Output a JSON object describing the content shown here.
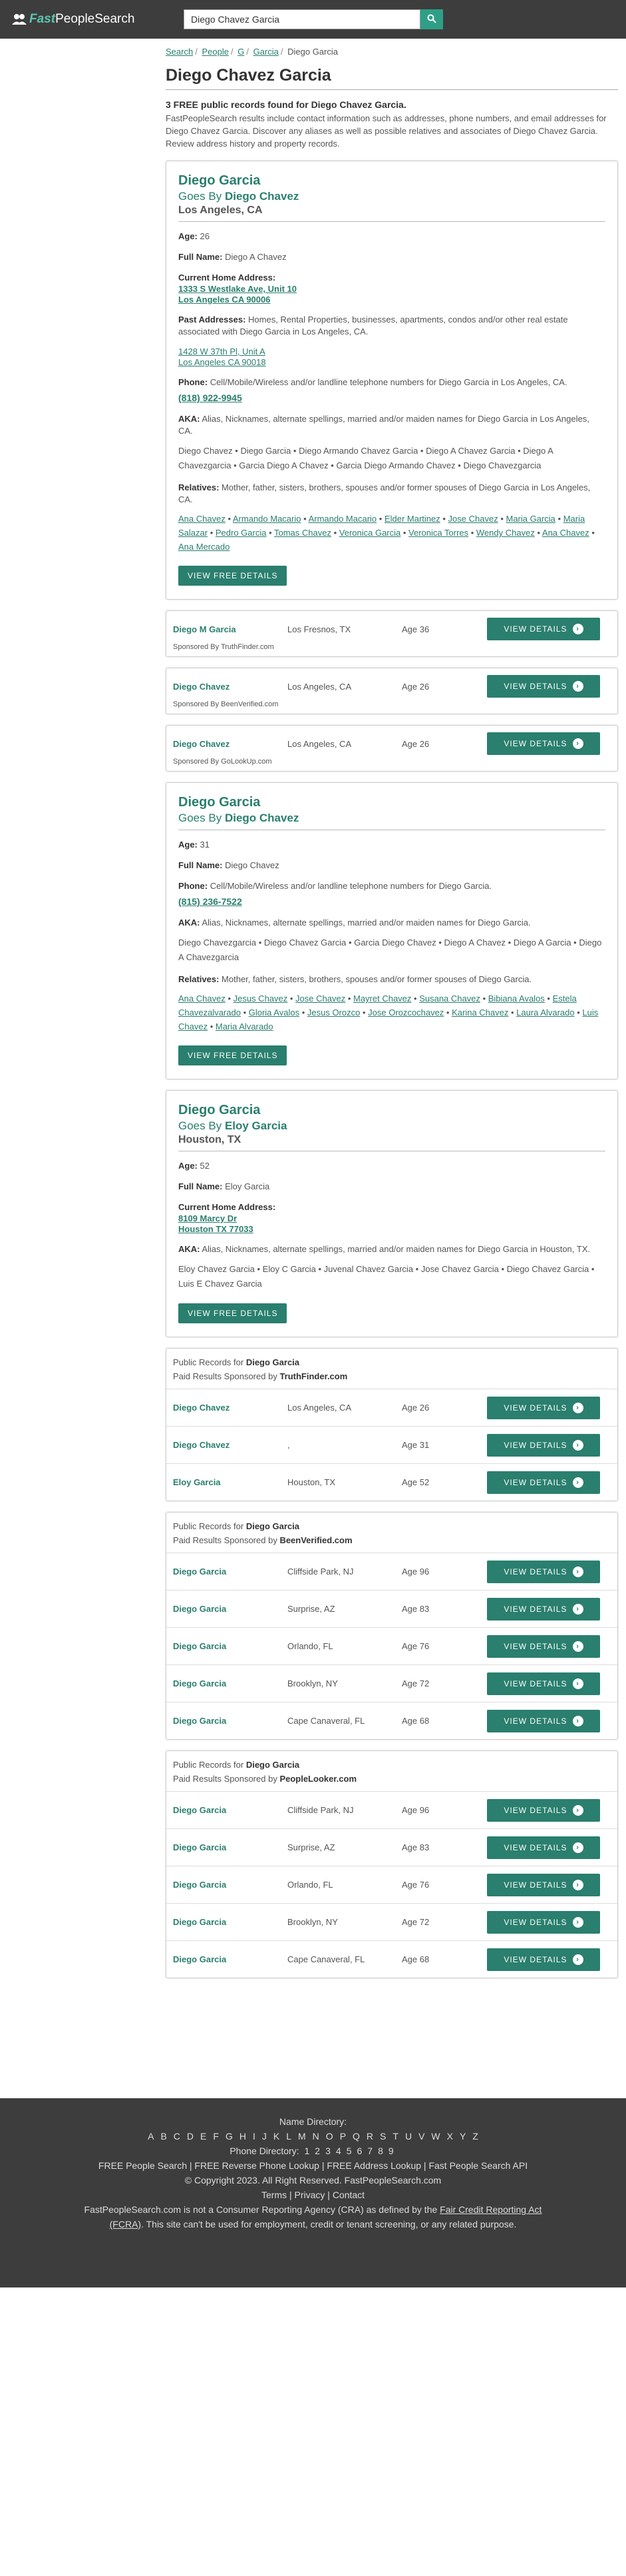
{
  "brand": {
    "fast": "Fast",
    "rest": "PeopleSearch"
  },
  "search": {
    "value": "Diego Chavez Garcia"
  },
  "breadcrumb": [
    "Search",
    "People",
    "G",
    "Garcia",
    "Diego Garcia"
  ],
  "page_title": "Diego Chavez Garcia",
  "summary": {
    "title": "3 FREE public records found for Diego Chavez Garcia.",
    "text": "FastPeopleSearch results include contact information such as addresses, phone numbers, and email addresses for Diego Chavez Garcia. Discover any aliases as well as possible relatives and associates of Diego Chavez Garcia. Review address history and property records."
  },
  "labels": {
    "age": "Age:",
    "full_name": "Full Name:",
    "current_address": "Current Home Address:",
    "past_addresses": "Past Addresses:",
    "phone": "Phone:",
    "aka": "AKA:",
    "relatives": "Relatives:",
    "goes_by": "Goes By",
    "view_free_details": "View Free Details",
    "view_details": "View Details",
    "public_records_for": "Public Records for",
    "paid_results": "Paid Results Sponsored by",
    "sponsored_by": "Sponsored By"
  },
  "record1": {
    "name": "Diego Garcia",
    "goes_by": "Diego Chavez",
    "location": "Los Angeles, CA",
    "age": "26",
    "full_name": "Diego A Chavez",
    "current_address_line1": "1333 S Westlake Ave, Unit 10",
    "current_address_line2": "Los Angeles CA 90006",
    "past_text": "Homes, Rental Properties, businesses, apartments, condos and/or other real estate associated with Diego Garcia in Los Angeles, CA.",
    "past_address_line1": "1428 W 37th Pl, Unit A",
    "past_address_line2": "Los Angeles CA 90018",
    "phone_text": "Cell/Mobile/Wireless and/or landline telephone numbers for Diego Garcia in Los Angeles, CA.",
    "phone": "(818) 922-9945",
    "aka_text": "Alias, Nicknames, alternate spellings, married and/or maiden names for Diego Garcia in Los Angeles, CA.",
    "aliases": [
      "Diego Chavez",
      "Diego Garcia",
      "Diego Armando Chavez Garcia",
      "Diego A Chavez Garcia",
      "Diego A Chavezgarcia",
      "Garcia Diego A Chavez",
      "Garcia Diego Armando Chavez",
      "Diego Chavezgarcia"
    ],
    "relatives_text": "Mother, father, sisters, brothers, spouses and/or former spouses of Diego Garcia in Los Angeles, CA.",
    "relatives": [
      "Ana Chavez",
      "Armando Macario",
      "Armando Macario",
      "Elder Martinez",
      "Jose Chavez",
      "Maria Garcia",
      "Maria Salazar",
      "Pedro Garcia",
      "Tomas Chavez",
      "Veronica Garcia",
      "Veronica Torres",
      "Wendy Chavez",
      "Ana Chavez",
      "Ana Mercado"
    ]
  },
  "sponsored": [
    {
      "name": "Diego M Garcia",
      "location": "Los Fresnos, TX",
      "age": "Age 36",
      "sponsor": "TruthFinder.com"
    },
    {
      "name": "Diego Chavez",
      "location": "Los Angeles, CA",
      "age": "Age 26",
      "sponsor": "BeenVerified.com"
    },
    {
      "name": "Diego Chavez",
      "location": "Los Angeles, CA",
      "age": "Age 26",
      "sponsor": "GoLookUp.com"
    }
  ],
  "record2": {
    "name": "Diego Garcia",
    "goes_by": "Diego Chavez",
    "age": "31",
    "full_name": "Diego Chavez",
    "phone_text": "Cell/Mobile/Wireless and/or landline telephone numbers for Diego Garcia.",
    "phone": "(815) 236-7522",
    "aka_text": "Alias, Nicknames, alternate spellings, married and/or maiden names for Diego Garcia.",
    "aliases": [
      "Diego Chavezgarcia",
      "Diego Chavez Garcia",
      "Garcia Diego Chavez",
      "Diego A Chavez",
      "Diego A Garcia",
      "Diego A Chavezgarcia"
    ],
    "relatives_text": "Mother, father, sisters, brothers, spouses and/or former spouses of Diego Garcia.",
    "relatives": [
      "Ana Chavez",
      "Jesus Chavez",
      "Jose Chavez",
      "Mayret Chavez",
      "Susana Chavez",
      "Bibiana Avalos",
      "Estela Chavezalvarado",
      "Gloria Avalos",
      "Jesus Orozco",
      "Jose Orozcochavez",
      "Karina Chavez",
      "Laura Alvarado",
      "Luis Chavez",
      "Maria Alvarado"
    ]
  },
  "record3": {
    "name": "Diego Garcia",
    "goes_by": "Eloy Garcia",
    "location": "Houston, TX",
    "age": "52",
    "full_name": "Eloy Garcia",
    "current_address_line1": "8109 Marcy Dr",
    "current_address_line2": "Houston TX 77033",
    "aka_text": "Alias, Nicknames, alternate spellings, married and/or maiden names for Diego Garcia in Houston, TX.",
    "aliases": [
      "Eloy Chavez Garcia",
      "Eloy C Garcia",
      "Juvenal Chavez Garcia",
      "Jose Chavez Garcia",
      "Diego Chavez Garcia",
      "Luis E Chavez Garcia"
    ]
  },
  "paid_blocks": [
    {
      "query": "Diego Garcia",
      "sponsor": "TruthFinder.com",
      "rows": [
        {
          "name": "Diego Chavez",
          "location": "Los Angeles, CA",
          "age": "Age 26"
        },
        {
          "name": "Diego Chavez",
          "location": ",",
          "age": "Age 31"
        },
        {
          "name": "Eloy Garcia",
          "location": "Houston, TX",
          "age": "Age 52"
        }
      ]
    },
    {
      "query": "Diego Garcia",
      "sponsor": "BeenVerified.com",
      "rows": [
        {
          "name": "Diego Garcia",
          "location": "Cliffside Park, NJ",
          "age": "Age 96"
        },
        {
          "name": "Diego Garcia",
          "location": "Surprise, AZ",
          "age": "Age 83"
        },
        {
          "name": "Diego Garcia",
          "location": "Orlando, FL",
          "age": "Age 76"
        },
        {
          "name": "Diego Garcia",
          "location": "Brooklyn, NY",
          "age": "Age 72"
        },
        {
          "name": "Diego Garcia",
          "location": "Cape Canaveral, FL",
          "age": "Age 68"
        }
      ]
    },
    {
      "query": "Diego Garcia",
      "sponsor": "PeopleLooker.com",
      "rows": [
        {
          "name": "Diego Garcia",
          "location": "Cliffside Park, NJ",
          "age": "Age 96"
        },
        {
          "name": "Diego Garcia",
          "location": "Surprise, AZ",
          "age": "Age 83"
        },
        {
          "name": "Diego Garcia",
          "location": "Orlando, FL",
          "age": "Age 76"
        },
        {
          "name": "Diego Garcia",
          "location": "Brooklyn, NY",
          "age": "Age 72"
        },
        {
          "name": "Diego Garcia",
          "location": "Cape Canaveral, FL",
          "age": "Age 68"
        }
      ]
    }
  ],
  "footer": {
    "name_directory": "Name Directory:",
    "letters": [
      "A",
      "B",
      "C",
      "D",
      "E",
      "F",
      "G",
      "H",
      "I",
      "J",
      "K",
      "L",
      "M",
      "N",
      "O",
      "P",
      "Q",
      "R",
      "S",
      "T",
      "U",
      "V",
      "W",
      "X",
      "Y",
      "Z"
    ],
    "phone_directory": "Phone Directory:",
    "digits": [
      "1",
      "2",
      "3",
      "4",
      "5",
      "6",
      "7",
      "8",
      "9"
    ],
    "links": [
      "FREE People Search",
      "FREE Reverse Phone Lookup",
      "FREE Address Lookup",
      "Fast People Search API"
    ],
    "copyright": "© Copyright 2023. All Right Reserved. FastPeopleSearch.com",
    "legal_links": [
      "Terms",
      "Privacy",
      "Contact"
    ],
    "disclaimer_pre": "FastPeopleSearch.com is not a Consumer Reporting Agency (CRA) as defined by the",
    "disclaimer_link": "Fair Credit Reporting Act (FCRA)",
    "disclaimer_post": ". This site can't be used for employment, credit or tenant screening, or any related purpose."
  },
  "colors": {
    "accent": "#2a7f6e",
    "header_bg": "#3d3d3d",
    "search_btn": "#2e9f86"
  },
  "icons": [
    "people-logo-icon",
    "search-icon",
    "arrow-right-icon"
  ]
}
